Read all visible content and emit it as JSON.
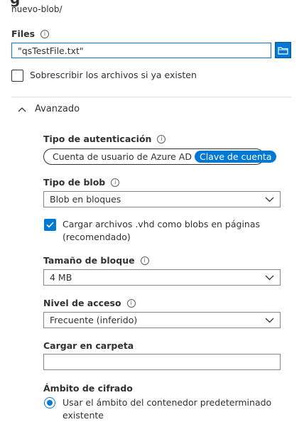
{
  "header": {
    "path": "nuevo-blob/"
  },
  "files": {
    "label": "Files",
    "value": "\"qsTestFile.txt\"",
    "overwrite_label": "Sobrescribir los archivos si ya existen"
  },
  "advanced": {
    "title": "Avanzado",
    "auth": {
      "label": "Tipo de autenticación",
      "options": [
        "Cuenta de usuario de Azure AD",
        "Clave de cuenta"
      ],
      "selected": "Clave de cuenta"
    },
    "blob_type": {
      "label": "Tipo de blob",
      "value": "Blob en bloques"
    },
    "vhd": {
      "label_line1": "Cargar archivos .vhd como blobs en páginas",
      "label_line2": "(recomendado)"
    },
    "block_size": {
      "label": "Tamaño de bloque",
      "value": "4 MB"
    },
    "access_tier": {
      "label": "Nivel de acceso",
      "value": "Frecuente (inferido)"
    },
    "folder": {
      "label": "Cargar en carpeta",
      "value": ""
    },
    "encryption": {
      "label": "Ámbito de cifrado",
      "option_line1": "Usar el ámbito del contenedor predeterminado",
      "option_line2": "existente"
    }
  },
  "colors": {
    "accent": "#0078d4",
    "text": "#323130",
    "border": "#8a8886"
  },
  "icons": {
    "info": "info-icon",
    "folder": "folder-icon",
    "chevron": "chevron-down-icon"
  }
}
